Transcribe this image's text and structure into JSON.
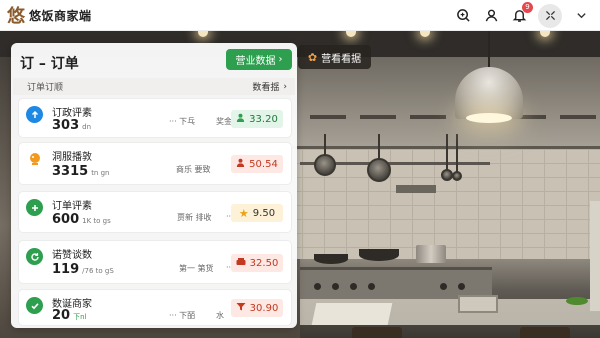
{
  "app": {
    "title": "悠饭商家端",
    "logo_glyph": "悠"
  },
  "topbar": {
    "notification_count": "9",
    "icons": [
      "scan-icon",
      "user-icon",
      "bell-icon",
      "settings-icon",
      "chevron-down-icon"
    ]
  },
  "panel": {
    "title": "订 – 订单",
    "business_button": "营业数据",
    "subheader_left": "订单订顺",
    "subheader_right": "数看揺"
  },
  "overview_button": "营看看据",
  "cards": [
    {
      "title": "订政评素",
      "value": "303",
      "unit": "dn",
      "mid_left": "下乓",
      "mid_right": "奖金",
      "pill": "33.20",
      "pill_icon": "user-icon",
      "accent": "#1e88e5"
    },
    {
      "title": "洞服播敦",
      "value": "3315",
      "unit": "tn gn",
      "mid_left": "",
      "mid_right": "商乐 要致",
      "pill": "50.54",
      "pill_icon": "user-icon",
      "accent": "#f29a1b"
    },
    {
      "title": "订单评素",
      "value": "600",
      "unit": "1K to gs",
      "mid_left": "",
      "mid_right": "贾新 排收",
      "pill": "9.50",
      "pill_icon": "star-icon",
      "accent": "#2e9e4f"
    },
    {
      "title": "诺赞谈数",
      "value": "119",
      "unit": "/76 to gS",
      "mid_left": "",
      "mid_right": "第一 第货",
      "pill": "32.50",
      "pill_icon": "tray-icon",
      "accent": "#2e9e4f"
    },
    {
      "title": "数诞商家",
      "value": "20",
      "unit": "下nl",
      "mid_left": "下皕",
      "mid_right": "水",
      "pill": "30.90",
      "pill_icon": "funnel-icon",
      "accent": "#2e9e4f"
    }
  ]
}
